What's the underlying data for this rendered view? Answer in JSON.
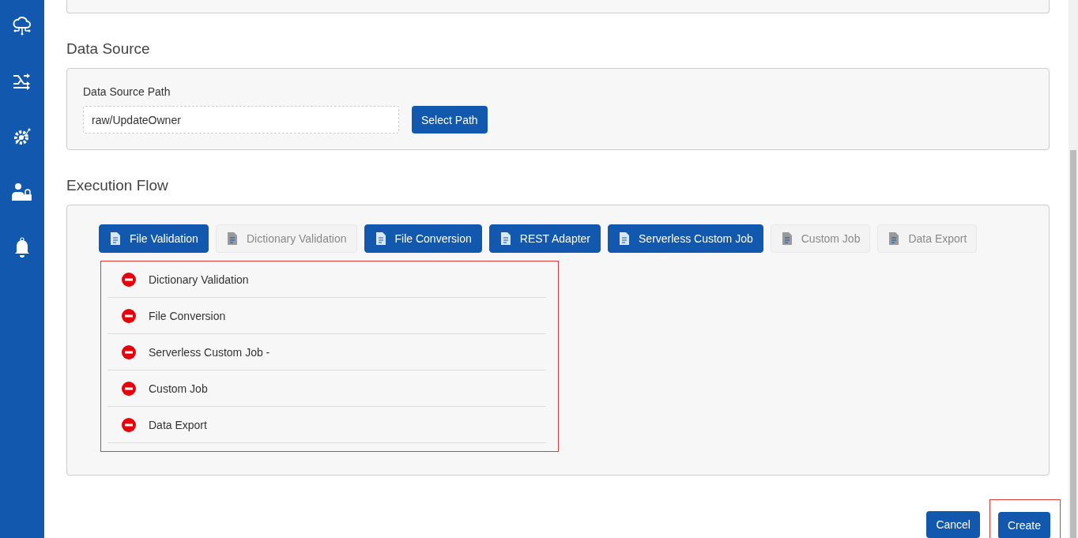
{
  "data_source": {
    "heading": "Data Source",
    "path_label": "Data Source Path",
    "path_value": "raw/UpdateOwner",
    "select_button": "Select Path"
  },
  "execution_flow": {
    "heading": "Execution Flow",
    "steps": [
      {
        "label": "File Validation",
        "disabled": false
      },
      {
        "label": "Dictionary Validation",
        "disabled": true
      },
      {
        "label": "File Conversion",
        "disabled": false
      },
      {
        "label": "REST Adapter",
        "disabled": false
      },
      {
        "label": "Serverless Custom Job",
        "disabled": false
      },
      {
        "label": "Custom Job",
        "disabled": true
      },
      {
        "label": "Data Export",
        "disabled": true
      }
    ],
    "selected_steps": [
      "Dictionary Validation",
      "File Conversion",
      "Serverless Custom Job -",
      "Custom Job",
      "Data Export"
    ]
  },
  "actions": {
    "cancel": "Cancel",
    "create": "Create"
  }
}
